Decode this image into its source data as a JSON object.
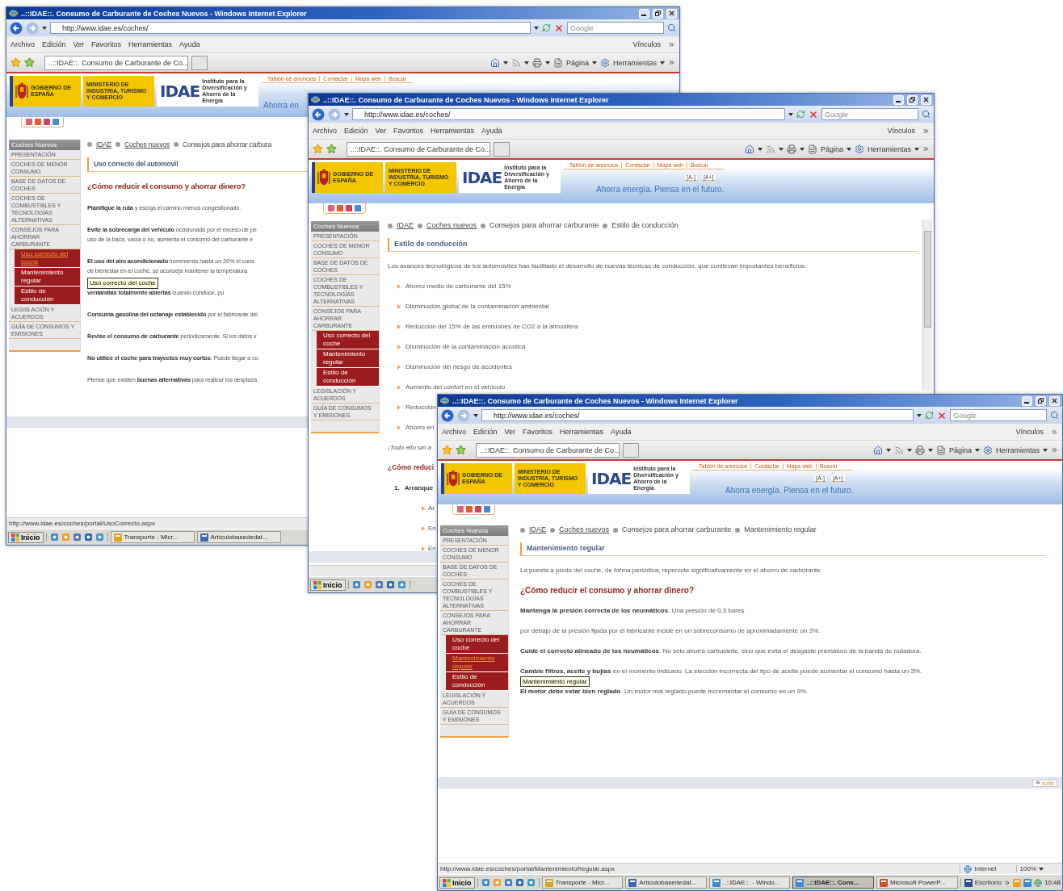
{
  "windows": [
    {
      "title": "..::IDAE::. Consumo de Carburante de Coches Nuevos - Windows Internet Explorer",
      "address": "http://www.idae.es/coches/",
      "search_placeholder": "Google",
      "menu": [
        "Archivo",
        "Edición",
        "Ver",
        "Favoritos",
        "Herramientas",
        "Ayuda"
      ],
      "links_label": "Vínculos",
      "tab": "..::IDAE::. Consumo de Carburante de Co...",
      "commands": [
        "Página",
        "Herramientas"
      ],
      "header": {
        "logos": [
          {
            "kind": "government",
            "text": "GOBIERNO DE ESPAÑA"
          },
          {
            "kind": "ministry",
            "text": "MINISTERIO DE INDUSTRIA, TURISMO Y COMERCIO"
          },
          {
            "kind": "idae",
            "text": "IDAE",
            "subtitle": "Instituto para la Diversificación y Ahorro de la Energía"
          }
        ],
        "top_links": [
          "Tablón de anuncios",
          "Contactar",
          "Mapa web",
          "Buscar"
        ],
        "slogan": "Ahorra en"
      },
      "sidebar": {
        "title": "Coches Nuevos",
        "items": [
          {
            "label": "PRESENTACIÓN"
          },
          {
            "label": "COCHES DE MENOR CONSUMO"
          },
          {
            "label": "BASE DE DATOS DE COCHES"
          },
          {
            "label": "COCHES DE COMBUSTIBLES Y TECNOLOGÍAS ALTERNATIVAS"
          },
          {
            "label": "CONSEJOS PARA AHORRAR CARBURANTE",
            "children": [
              {
                "label": "Uso correcto del coche",
                "selected": true
              },
              {
                "label": "Mantenimiento regular",
                "selected": false
              },
              {
                "label": "Estilo de conducción",
                "selected": false
              }
            ]
          },
          {
            "label": "LEGISLACIÓN Y ACUERDOS"
          },
          {
            "label": "GUÍA DE CONSUMOS Y EMISIONES"
          }
        ]
      },
      "breadcrumb": [
        {
          "label": "IDAE",
          "link": true
        },
        {
          "label": "Coches nuevos",
          "link": true
        },
        {
          "label": "Consejos para ahorrar carbura",
          "link": false
        }
      ],
      "section_title": "Uso correcto del automovil",
      "blocks": [
        {
          "kind": "heading",
          "text": "¿Cómo reducir el consumo y ahorrar dinero?"
        },
        {
          "kind": "paragraph",
          "lines": [
            "**Planifique la ruta** y escoja el camino menos congestionado."
          ]
        },
        {
          "kind": "paragraph",
          "lines": [
            "**Evite la sobrecarga del vehículo** ocasionada por el exceso de pe",
            "uso de la baca, vacía o no, aumenta el consumo del carburante e"
          ]
        },
        {
          "kind": "paragraph",
          "lines": [
            "**El uso del aire acondicionado** incrementa hasta un 20% el cons",
            "de bienestar en el coche, se aconseja mantener la temperatura"
          ]
        },
        {
          "kind": "paragraph",
          "lines": [
            "**ventanillas totalmente abiertas** cuando conduce, pu"
          ]
        },
        {
          "kind": "paragraph",
          "lines": [
            "**Consuma gasolina del octanaje establecido** por el fabricante del"
          ]
        },
        {
          "kind": "paragraph",
          "lines": [
            "**Revise el consumo de carburante** periódicamente. Si los datos v"
          ]
        },
        {
          "kind": "paragraph",
          "lines": [
            "**No utilice el coche para trayectos muy cortos**. Puede llegar a co"
          ]
        },
        {
          "kind": "paragraph",
          "lines": [
            "Piense que existen **buenas alternativas** para realizar los desplaza"
          ]
        }
      ],
      "tooltip": "Uso correcto del coche",
      "status_url": "http://www.idae.es/coches/portal/UsoCorrecto.aspx",
      "taskbar": {
        "start": "Inicio",
        "items": [
          {
            "label": "Transporte - Micr...",
            "selected": false
          },
          {
            "label": "Artículobasededat...",
            "selected": false
          }
        ]
      }
    },
    {
      "title": "..::IDAE::. Consumo de Carburante de Coches Nuevos - Windows Internet Explorer",
      "address": "http://www.idae.es/coches/",
      "search_placeholder": "Google",
      "menu": [
        "Archivo",
        "Edición",
        "Ver",
        "Favoritos",
        "Herramientas",
        "Ayuda"
      ],
      "links_label": "Vínculos",
      "tab": "..::IDAE::. Consumo de Carburante de Co...",
      "commands": [
        "Página",
        "Herramientas"
      ],
      "header": {
        "logos": [
          {
            "kind": "government",
            "text": "GOBIERNO DE ESPAÑA"
          },
          {
            "kind": "ministry",
            "text": "MINISTERIO DE INDUSTRIA, TURISMO Y COMERCIO"
          },
          {
            "kind": "idae",
            "text": "IDAE",
            "subtitle": "Instituto para la Diversificación y Ahorro de la Energía"
          }
        ],
        "top_links": [
          "Tablón de anuncios",
          "Contactar",
          "Mapa web",
          "Buscar"
        ],
        "text_size": [
          "[A-]",
          "[A+]"
        ],
        "slogan": "Ahorra energía. Piensa en el futuro."
      },
      "sidebar": {
        "title": "Coches Nuevos",
        "items": [
          {
            "label": "PRESENTACIÓN"
          },
          {
            "label": "COCHES DE MENOR CONSUMO"
          },
          {
            "label": "BASE DE DATOS DE COCHES"
          },
          {
            "label": "COCHES DE COMBUSTIBLES Y TECNOLOGÍAS ALTERNATIVAS"
          },
          {
            "label": "CONSEJOS PARA AHORRAR CARBURANTE",
            "children": [
              {
                "label": "Uso correcto del coche",
                "selected": false
              },
              {
                "label": "Mantenimiento regular",
                "selected": false
              },
              {
                "label": "Estilo de conducción",
                "selected": false
              }
            ]
          },
          {
            "label": "LEGISLACIÓN Y ACUERDOS"
          },
          {
            "label": "GUÍA DE CONSUMOS Y EMISIONES"
          }
        ]
      },
      "breadcrumb": [
        {
          "label": "IDAE",
          "link": true
        },
        {
          "label": "Coches nuevos",
          "link": true
        },
        {
          "label": "Consejos para ahorrar carburante",
          "link": false
        },
        {
          "label": "Estilo de conducción",
          "link": false
        }
      ],
      "section_title": "Estilo de conducción",
      "blocks": [
        {
          "kind": "paragraph",
          "lines": [
            "Los avances tecnológicos de los automóviles han facilitado el desarrollo de nuevas técnicas de conducción, que conllevan importantes beneficios:"
          ]
        },
        {
          "kind": "bullet",
          "text": "Ahorro medio de carburante del 15%"
        },
        {
          "kind": "bullet",
          "text": "Disminución global de la contaminación ambiental"
        },
        {
          "kind": "bullet",
          "text": "Reducción del 15% de las emisiones de CO2 a la atmósfera"
        },
        {
          "kind": "bullet",
          "text": "Disminución de la contaminación acústica"
        },
        {
          "kind": "bullet",
          "text": "Disminución del riesgo de accidentes"
        },
        {
          "kind": "bullet",
          "text": "Aumento del confort en el vehículo"
        },
        {
          "kind": "bullet",
          "text": "Reducción"
        },
        {
          "kind": "bullet",
          "text": "Ahorro en"
        },
        {
          "kind": "note",
          "text": "¡Todo ello sin a"
        },
        {
          "kind": "heading",
          "text": "¿Cómo reduci"
        },
        {
          "kind": "numbered",
          "number": "1.",
          "text": "Arranque"
        },
        {
          "kind": "subbullet",
          "text": "Ar"
        },
        {
          "kind": "subbullet",
          "text": "En"
        },
        {
          "kind": "subbullet",
          "text": "En"
        }
      ],
      "taskbar": {
        "start": "Inicio"
      }
    },
    {
      "title": "..::IDAE::. Consumo de Carburante de Coches Nuevos - Windows Internet Explorer",
      "address": "http://www.idae.es/coches/",
      "search_placeholder": "Google",
      "menu": [
        "Archivo",
        "Edición",
        "Ver",
        "Favoritos",
        "Herramientas",
        "Ayuda"
      ],
      "links_label": "Vínculos",
      "tab": "..::IDAE::. Consumo de Carburante de Co...",
      "commands": [
        "Página",
        "Herramientas"
      ],
      "header": {
        "logos": [
          {
            "kind": "government",
            "text": "GOBIERNO DE ESPAÑA"
          },
          {
            "kind": "ministry",
            "text": "MINISTERIO DE INDUSTRIA, TURISMO Y COMERCIO"
          },
          {
            "kind": "idae",
            "text": "IDAE",
            "subtitle": "Instituto para la Diversificación y Ahorro de la Energía"
          }
        ],
        "top_links": [
          "Tablón de anuncios",
          "Contactar",
          "Mapa web",
          "Buscar"
        ],
        "text_size": [
          "[A-]",
          "[A+]"
        ],
        "slogan": "Ahorra energía. Piensa en el futuro."
      },
      "sidebar": {
        "title": "Coches Nuevos",
        "items": [
          {
            "label": "PRESENTACIÓN"
          },
          {
            "label": "COCHES DE MENOR CONSUMO"
          },
          {
            "label": "BASE DE DATOS DE COCHES"
          },
          {
            "label": "COCHES DE COMBUSTIBLES Y TECNOLOGÍAS ALTERNATIVAS"
          },
          {
            "label": "CONSEJOS PARA AHORRAR CARBURANTE",
            "children": [
              {
                "label": "Uso correcto del coche",
                "selected": false
              },
              {
                "label": "Mantenimiento regular",
                "selected": true
              },
              {
                "label": "Estilo de conducción",
                "selected": false
              }
            ]
          },
          {
            "label": "LEGISLACIÓN Y ACUERDOS"
          },
          {
            "label": "GUÍA DE CONSUMOS Y EMISIONES"
          }
        ]
      },
      "breadcrumb": [
        {
          "label": "IDAE",
          "link": true
        },
        {
          "label": "Coches nuevos",
          "link": true
        },
        {
          "label": "Consejos para ahorrar carburante",
          "link": false
        },
        {
          "label": "Mantenimiento regular",
          "link": false
        }
      ],
      "section_title": "Mantenimiento regular",
      "blocks": [
        {
          "kind": "paragraph",
          "lines": [
            "La puesta a punto del coche, de forma periódica, repercute significativamente en el ahorro de carburante."
          ]
        },
        {
          "kind": "heading",
          "text": "¿Cómo reducir el consumo y ahorrar dinero?"
        },
        {
          "kind": "paragraph",
          "lines": [
            "**Mantenga la presión correcta de los neumáticos**. Una presión de 0,3 bares"
          ]
        },
        {
          "kind": "paragraph",
          "lines": [
            "por debajo de la presión fijada por el fabricante incide en un sobreconsumo de aproximadamente un 3%."
          ]
        },
        {
          "kind": "paragraph",
          "lines": [
            "**Cuide el correcto alineado de los neumáticos**. No sólo ahorra carburante, sino que evita el desgaste prematuro de la banda de rodadura."
          ]
        },
        {
          "kind": "paragraph",
          "lines": [
            "**Cambie filtros, aceite y bujías** en el momento indicado. La elección incorrecta del tipo de aceite puede aumentar el consumo hasta un 3%."
          ]
        },
        {
          "kind": "paragraph",
          "lines": [
            "**El motor debe estar bien reglado**. Un motor mal reglado puede incrementar el consumo en un 9%."
          ]
        }
      ],
      "tooltip": "Mantenimiento regular",
      "back_to_top": "subir",
      "status_url": "http://www.idae.es/coches/portal/MantenimientoRegular.aspx",
      "status_zone": "Internet",
      "zoom": "100%",
      "taskbar": {
        "start": "Inicio",
        "items": [
          {
            "label": "Transporte - Micr...",
            "selected": false
          },
          {
            "label": "Artículobasededat...",
            "selected": false
          },
          {
            "label": "..::IDAE::. - Windo...",
            "selected": false
          },
          {
            "label": "..::IDAE::. Cons...",
            "selected": true
          },
          {
            "label": "Microsoft PowerP...",
            "selected": false
          }
        ],
        "toolbar": "Escritorio",
        "clock": "10:48"
      }
    }
  ]
}
